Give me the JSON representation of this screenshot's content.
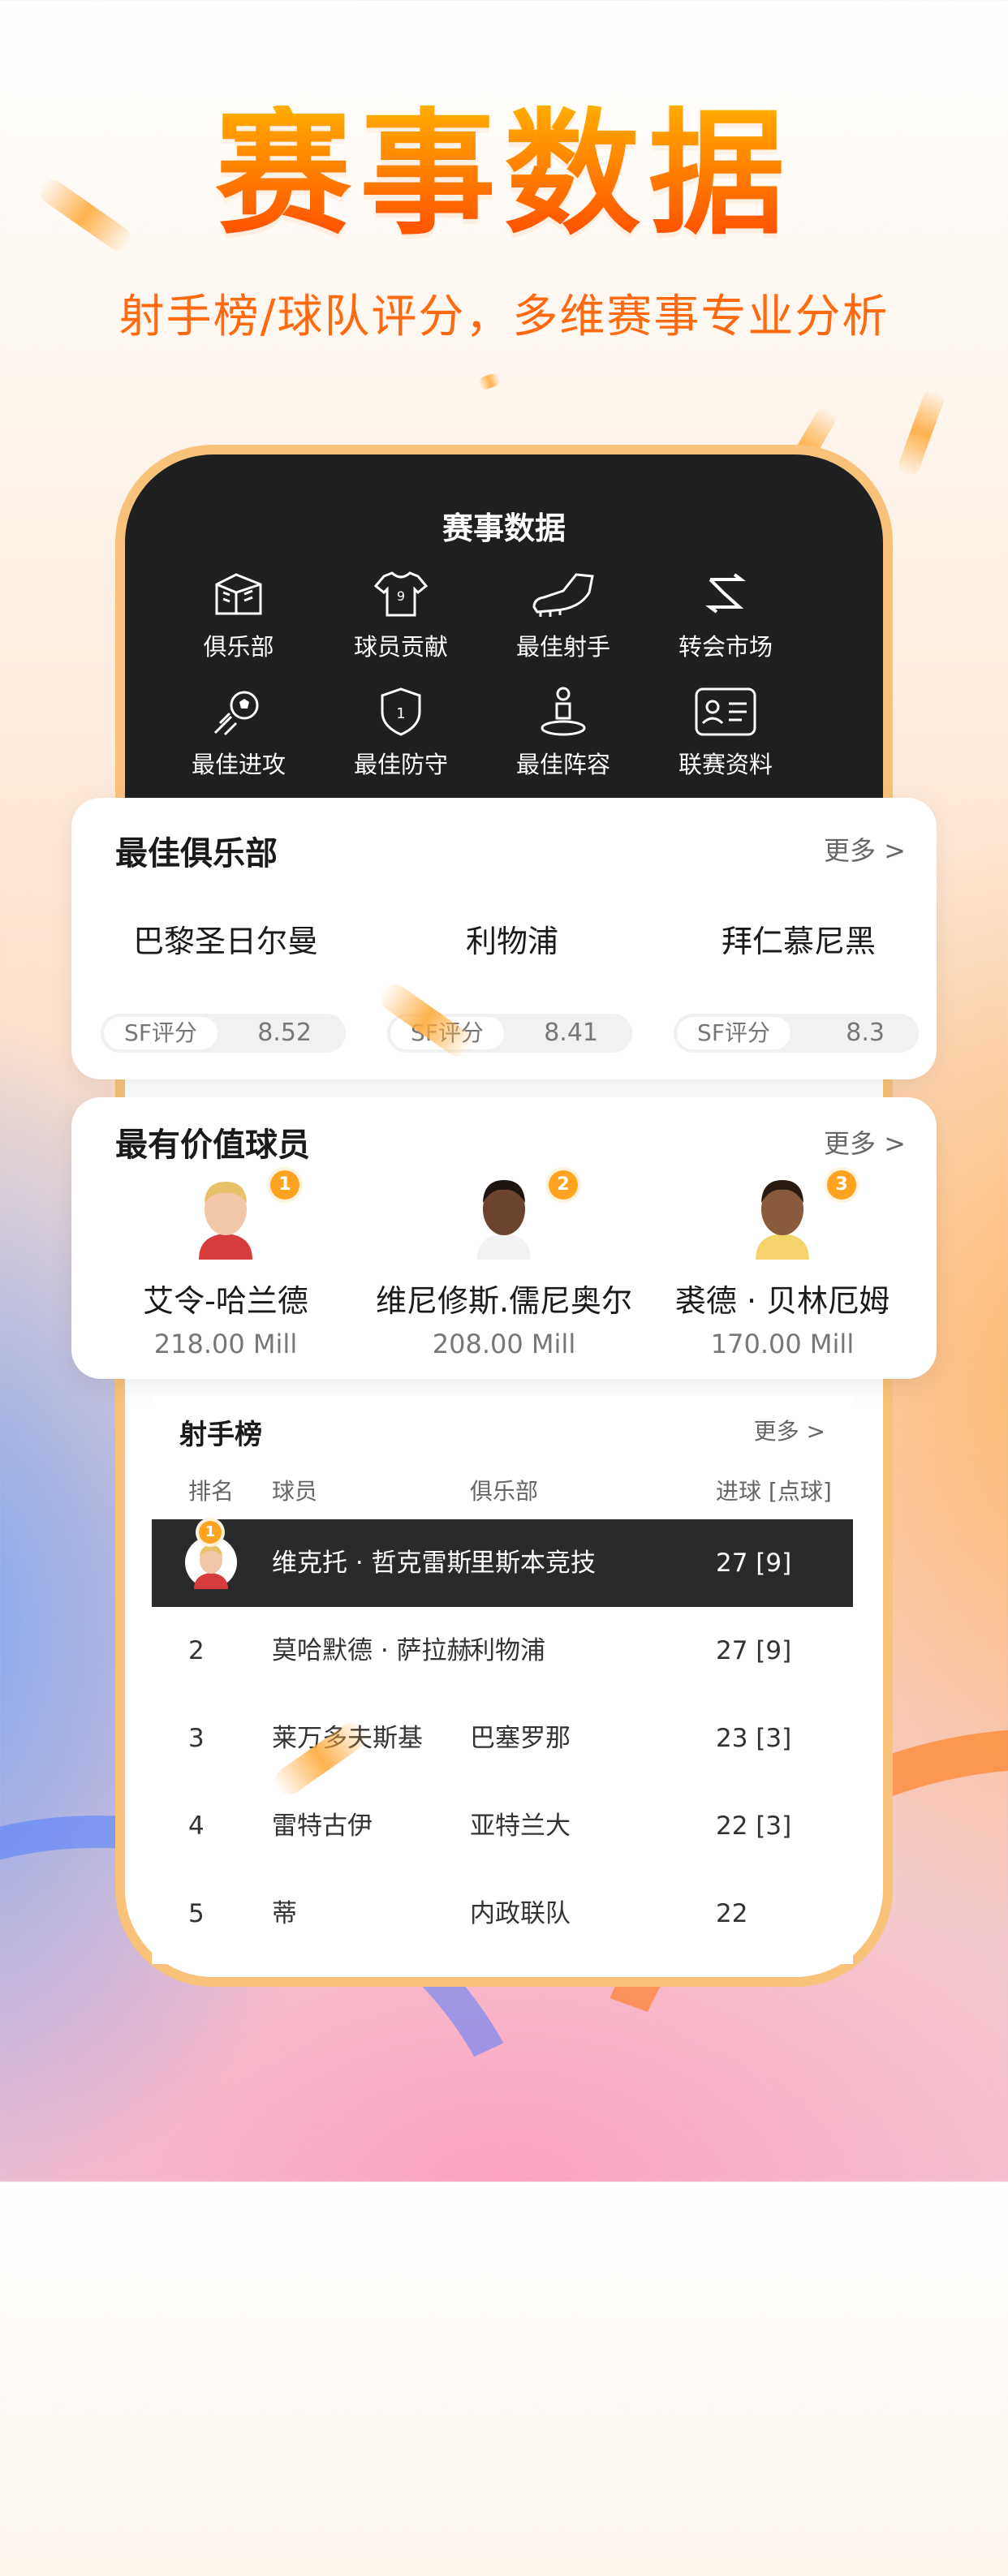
{
  "headline": "赛事数据",
  "subline": "射手榜/球队评分，多维赛事专业分析",
  "panel": {
    "title": "赛事数据",
    "items": [
      {
        "label": "俱乐部",
        "icon": "stadium-icon"
      },
      {
        "label": "球员贡献",
        "icon": "jersey-icon"
      },
      {
        "label": "最佳射手",
        "icon": "football-boot-icon"
      },
      {
        "label": "转会市场",
        "icon": "transfer-arrows-icon"
      },
      {
        "label": "最佳进攻",
        "icon": "ball-kick-icon"
      },
      {
        "label": "最佳防守",
        "icon": "shield-icon"
      },
      {
        "label": "最佳阵容",
        "icon": "player-position-icon"
      },
      {
        "label": "联赛资料",
        "icon": "id-card-icon"
      }
    ]
  },
  "best_clubs": {
    "title": "最佳俱乐部",
    "more": "更多 >",
    "rating_label": "SF评分",
    "clubs": [
      {
        "name": "巴黎圣日尔曼",
        "rating": "8.52"
      },
      {
        "name": "利物浦",
        "rating": "8.41"
      },
      {
        "name": "拜仁慕尼黑",
        "rating": "8.3"
      }
    ]
  },
  "valuable_players": {
    "title": "最有价值球员",
    "more": "更多 >",
    "players": [
      {
        "rank": "1",
        "name": "艾令-哈兰德",
        "value": "218.00 Mill"
      },
      {
        "rank": "2",
        "name": "维尼修斯.儒尼奥尔",
        "value": "208.00 Mill"
      },
      {
        "rank": "3",
        "name": "裘德 · 贝林厄姆",
        "value": "170.00 Mill"
      }
    ]
  },
  "scorers": {
    "title": "射手榜",
    "more": "更多 >",
    "headers": {
      "rank": "排名",
      "player": "球员",
      "club": "俱乐部",
      "goals": "进球 [点球]"
    },
    "rows": [
      {
        "rank": "1",
        "player": "维克托 · 哲克雷斯",
        "club": "里斯本竞技",
        "goals": "27 [9]"
      },
      {
        "rank": "2",
        "player": "莫哈默德 · 萨拉赫",
        "club": "利物浦",
        "goals": "27 [9]"
      },
      {
        "rank": "3",
        "player": "莱万多夫斯基",
        "club": "巴塞罗那",
        "goals": "23 [3]"
      },
      {
        "rank": "4",
        "player": "雷特古伊",
        "club": "亚特兰大",
        "goals": "22 [3]"
      },
      {
        "rank": "5",
        "player": "蒂",
        "club": "内政联队",
        "goals": "22"
      }
    ]
  },
  "colors": {
    "accent": "#ff7a00",
    "dark": "#1f1f1f",
    "badge": "#ffa320"
  }
}
